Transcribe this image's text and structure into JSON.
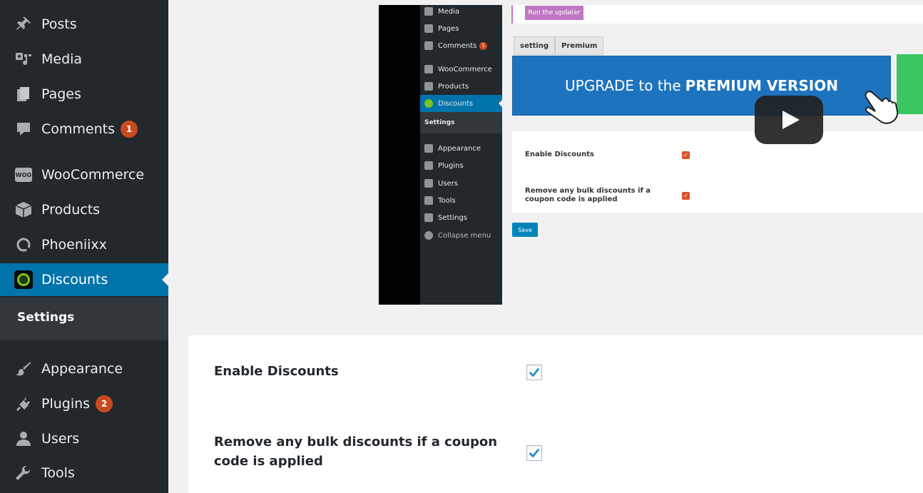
{
  "sidebar": {
    "items": [
      {
        "label": "Posts",
        "icon": "pushpin-icon"
      },
      {
        "label": "Media",
        "icon": "media-icon"
      },
      {
        "label": "Pages",
        "icon": "pages-icon"
      },
      {
        "label": "Comments",
        "icon": "comment-icon",
        "badge": "1"
      },
      {
        "label": "WooCommerce",
        "icon": "woocommerce-icon"
      },
      {
        "label": "Products",
        "icon": "products-box-icon"
      },
      {
        "label": "Phoeniixx",
        "icon": "phoeniixx-icon"
      },
      {
        "label": "Discounts",
        "icon": "discounts-plugin-icon",
        "current": true
      },
      {
        "label": "Appearance",
        "icon": "paintbrush-icon"
      },
      {
        "label": "Plugins",
        "icon": "plugin-icon",
        "badge": "2"
      },
      {
        "label": "Users",
        "icon": "users-icon"
      },
      {
        "label": "Tools",
        "icon": "wrench-icon"
      }
    ],
    "submenu": {
      "label": "Settings"
    }
  },
  "video": {
    "sidebar_items": [
      {
        "label": "Media"
      },
      {
        "label": "Pages"
      },
      {
        "label": "Comments",
        "badge": "1"
      },
      {
        "label": "WooCommerce"
      },
      {
        "label": "Products"
      },
      {
        "label": "Discounts"
      },
      {
        "label": "Settings"
      },
      {
        "label": "Appearance"
      },
      {
        "label": "Plugins"
      },
      {
        "label": "Users"
      },
      {
        "label": "Tools"
      },
      {
        "label": "Settings"
      },
      {
        "label": "Collapse menu"
      }
    ],
    "updater_button": "Run the updater",
    "tabs": [
      "setting",
      "Premium"
    ],
    "banner": {
      "text": "UPGRADE to the",
      "bold": "PREMIUM VERSION"
    },
    "fields": [
      {
        "label": "Enable Discounts",
        "checked": true
      },
      {
        "label": "Remove any bulk discounts if a coupon code is applied",
        "checked": true
      }
    ],
    "save_button": "Save"
  },
  "settings": {
    "enable_discounts": {
      "label": "Enable Discounts",
      "checked": true
    },
    "remove_bulk": {
      "label": "Remove any bulk discounts if a coupon code is applied",
      "checked": true
    }
  },
  "colors": {
    "sidebar_bg": "#23282d",
    "accent": "#0073aa",
    "badge": "#ca4a1f",
    "checkmark": "#1e8cbe"
  }
}
